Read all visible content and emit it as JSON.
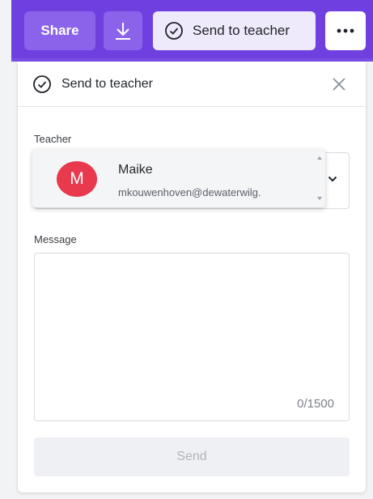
{
  "toolbar": {
    "share_label": "Share",
    "download_icon": "download-icon",
    "send_to_teacher_label": "Send to teacher",
    "more_icon": "more-horizontal-icon"
  },
  "panel": {
    "title": "Send to teacher",
    "teacher_label": "Teacher",
    "teacher_option": {
      "avatar_initial": "M",
      "name": "Maike",
      "email": "mkouwenhoven@dewaterwilg."
    },
    "message_label": "Message",
    "message_value": "",
    "char_count": "0/1500",
    "send_label": "Send"
  },
  "colors": {
    "toolbar_bg": "#6f3fe0",
    "toolbar_button_bg": "#8a63ea",
    "active_button_bg": "#efe9fc",
    "avatar_bg": "#e8394d",
    "disabled_button_bg": "#eef0f3"
  }
}
